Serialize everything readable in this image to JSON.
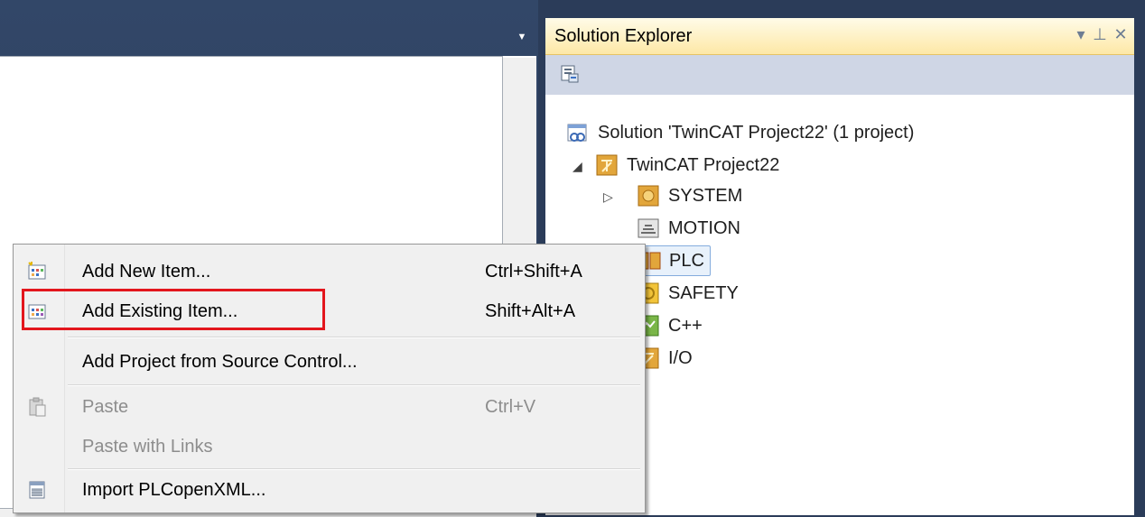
{
  "solution_explorer": {
    "title": "Solution Explorer",
    "controls": {
      "dropdown": "▾",
      "pin": "⊥",
      "close": "✕"
    },
    "tree": {
      "solution": "Solution 'TwinCAT Project22' (1 project)",
      "project": "TwinCAT Project22",
      "children": [
        "SYSTEM",
        "MOTION",
        "PLC",
        "SAFETY",
        "C++",
        "I/O"
      ]
    }
  },
  "context_menu": {
    "items": [
      {
        "label": "Add New Item...",
        "shortcut": "Ctrl+Shift+A",
        "enabled": true
      },
      {
        "label": "Add Existing Item...",
        "shortcut": "Shift+Alt+A",
        "enabled": true
      },
      {
        "label": "Add Project from Source Control...",
        "shortcut": "",
        "enabled": true
      },
      {
        "label": "Paste",
        "shortcut": "Ctrl+V",
        "enabled": false
      },
      {
        "label": "Paste with Links",
        "shortcut": "",
        "enabled": false
      },
      {
        "label": "Import PLCopenXML...",
        "shortcut": "",
        "enabled": true
      }
    ]
  },
  "colors": {
    "accent_highlight": "#e3161d",
    "background": "#2b3c59",
    "header": "#fde8a6"
  },
  "icons": {
    "toolbar": "properties-icon",
    "solution": "solution-icon",
    "project": "twincat-project-icon",
    "system": "system-icon",
    "motion": "motion-icon",
    "plc": "plc-icon",
    "safety": "safety-icon",
    "cpp": "cpp-icon",
    "io": "io-icon"
  }
}
